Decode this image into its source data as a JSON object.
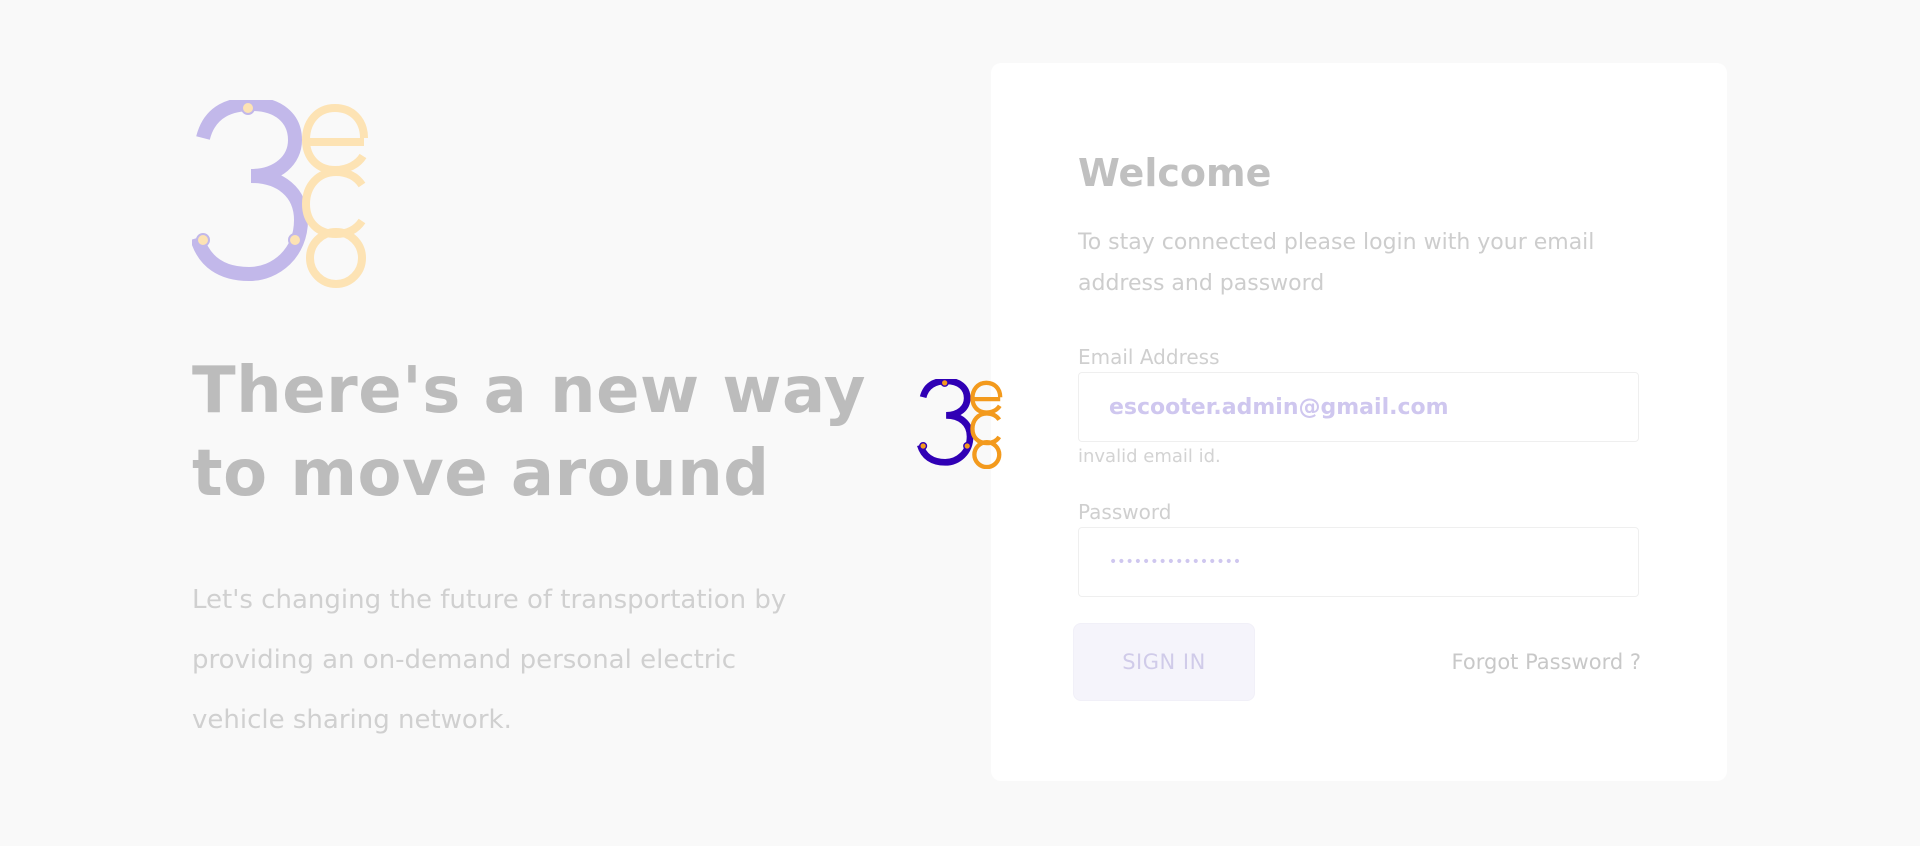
{
  "hero": {
    "title_line1": "There's a new way",
    "title_line2": "to move around",
    "description": "Let's changing the future of transportation by providing an on-demand personal electric vehicle sharing network."
  },
  "login": {
    "title": "Welcome",
    "subtitle": "To stay connected please login with your email address and password",
    "email_label": "Email Address",
    "email_value": "escooter.admin@gmail.com",
    "email_error": "invalid email id.",
    "password_label": "Password",
    "password_value": "••••••••••••••••",
    "signin_label": "SIGN IN",
    "forgot_label": "Forgot Password ?"
  },
  "logo": {
    "digit": "3",
    "letters": "eco"
  },
  "colors": {
    "brand_purple": "#3000b5",
    "brand_orange": "#f39a1d",
    "faded_purple": "#c2b8ea",
    "faded_orange": "#fde3b4"
  }
}
